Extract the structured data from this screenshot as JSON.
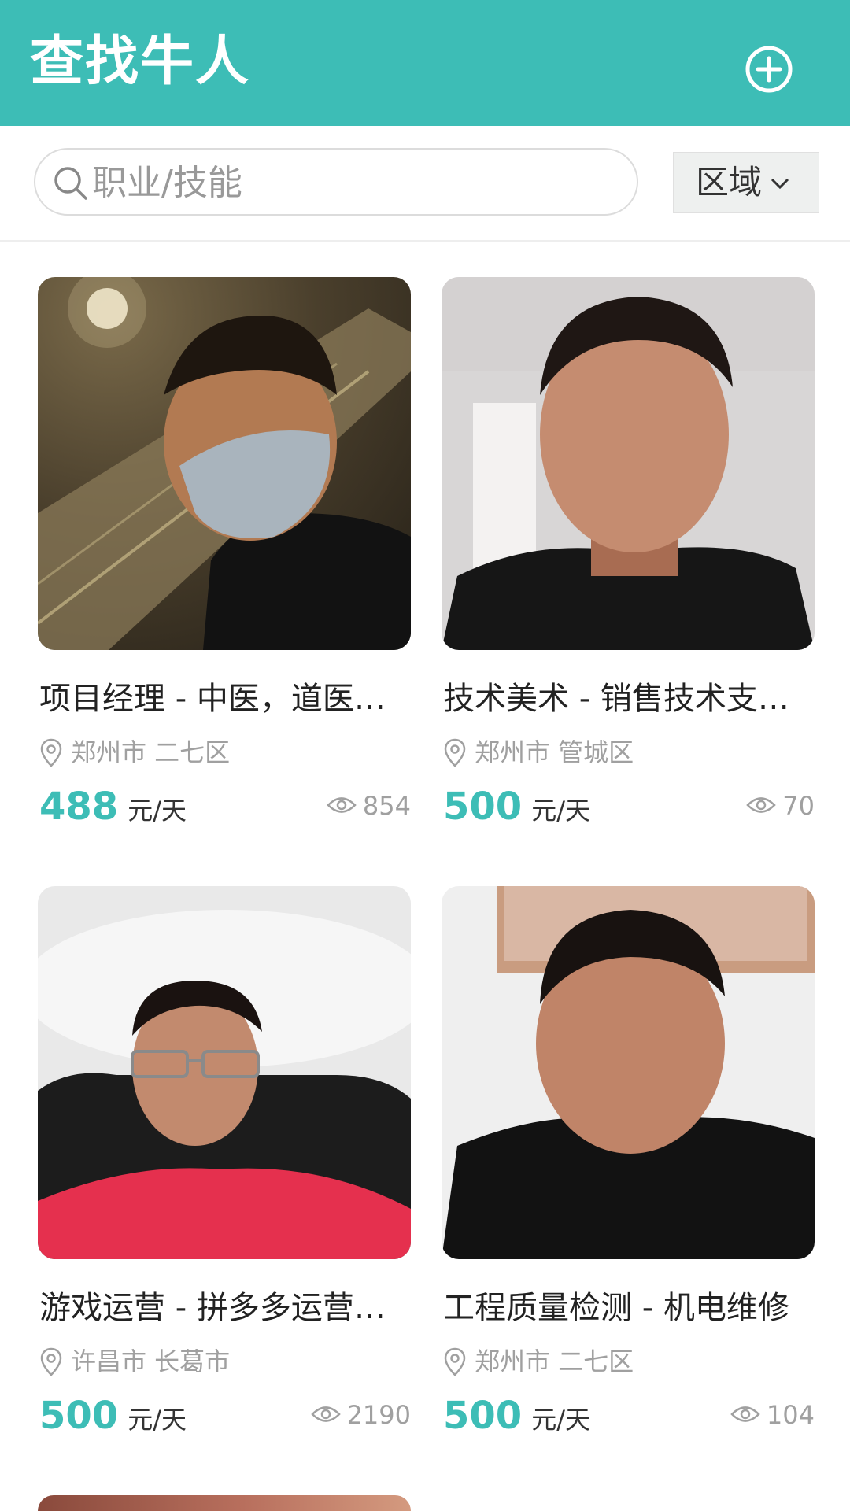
{
  "header": {
    "title": "查找牛人",
    "add_icon": "plus-circle-icon"
  },
  "search": {
    "placeholder": "职业/技能",
    "value": "",
    "icon": "search-icon",
    "region_label": "区域",
    "region_icon": "chevron-down-icon"
  },
  "colors": {
    "accent": "#3dbdb6",
    "text": "#222222",
    "muted": "#a0a0a0"
  },
  "cards": [
    {
      "title": "项目经理 - 中医，道医…",
      "location": "郑州市 二七区",
      "price": "488",
      "unit": "元/天",
      "views": "854"
    },
    {
      "title": "技术美术 - 销售技术支…",
      "location": "郑州市 管城区",
      "price": "500",
      "unit": "元/天",
      "views": "70"
    },
    {
      "title": "游戏运营 - 拼多多运营…",
      "location": "许昌市 长葛市",
      "price": "500",
      "unit": "元/天",
      "views": "2190"
    },
    {
      "title": "工程质量检测 - 机电维修",
      "location": "郑州市 二七区",
      "price": "500",
      "unit": "元/天",
      "views": "104"
    }
  ]
}
